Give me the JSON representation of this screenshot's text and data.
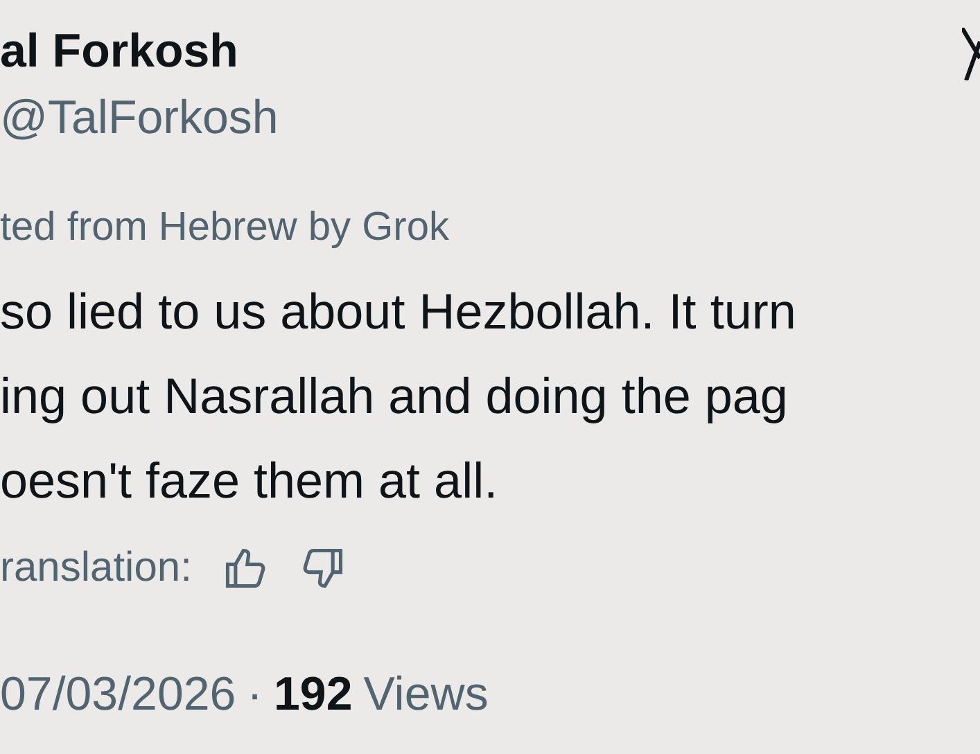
{
  "author": {
    "name": "al Forkosh",
    "handle": "@TalForkosh"
  },
  "translation_note": "ted from Hebrew by Grok",
  "body_lines": [
    "so lied to us about Hezbollah. It turn",
    "ing out Nasrallah and doing the pag",
    "oesn't faze them at all."
  ],
  "rate_label": "ranslation:",
  "meta": {
    "date": "07/03/2026",
    "separator": "·",
    "views_count": "192",
    "views_label": "Views"
  }
}
